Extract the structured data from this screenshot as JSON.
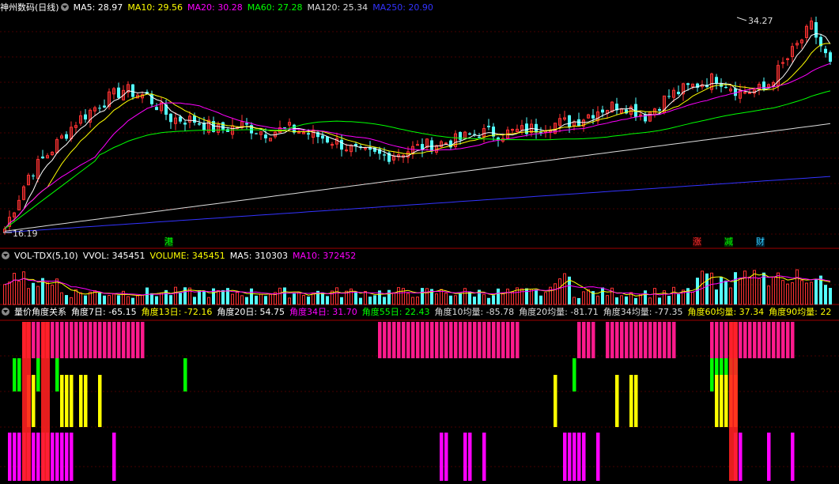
{
  "panels": {
    "price": {
      "title": "神州数码(日线)",
      "ma_items": [
        {
          "label": "MA5: 28.97",
          "color": "#ffffff"
        },
        {
          "label": "MA10: 29.56",
          "color": "#ffff00"
        },
        {
          "label": "MA20: 30.28",
          "color": "#ff00ff"
        },
        {
          "label": "MA60: 27.28",
          "color": "#00ff00"
        },
        {
          "label": "MA120: 25.34",
          "color": "#dddddd"
        },
        {
          "label": "MA250: 20.90",
          "color": "#3333ff"
        }
      ],
      "high_label": "34.27",
      "low_label": "16.19",
      "badges": [
        {
          "text": "港",
          "color": "#00ff00",
          "bg": "#003300"
        },
        {
          "text": "涨",
          "color": "#ff3333",
          "bg": "#330000"
        },
        {
          "text": "减",
          "color": "#00ff00",
          "bg": "#003300"
        },
        {
          "text": "财",
          "color": "#33ccff",
          "bg": "#002233"
        }
      ]
    },
    "volume": {
      "title": "VOL-TDX(5,10)",
      "items": [
        {
          "label": "VVOL: 345451",
          "color": "#ffffff"
        },
        {
          "label": "VOLUME: 345451",
          "color": "#ffff00"
        },
        {
          "label": "MA5: 310303",
          "color": "#ffffff"
        },
        {
          "label": "MA10: 372452",
          "color": "#ff00ff"
        }
      ]
    },
    "angle": {
      "title": "量价角度关系",
      "items": [
        {
          "label": "角度7日: -65.15",
          "color": "#ffffff"
        },
        {
          "label": "角度13日: -72.16",
          "color": "#ffff00"
        },
        {
          "label": "角度20日: 54.75",
          "color": "#ffffff"
        },
        {
          "label": "角度34日: 31.70",
          "color": "#ff00ff"
        },
        {
          "label": "角度55日: 22.43",
          "color": "#00ff00"
        },
        {
          "label": "角度10均量: -85.78",
          "color": "#dddddd"
        },
        {
          "label": "角度20均量: -81.71",
          "color": "#dddddd"
        },
        {
          "label": "角度34均量: -77.35",
          "color": "#dddddd"
        },
        {
          "label": "角度60均量: 37.34",
          "color": "#ffff00"
        },
        {
          "label": "角度90均量: 22",
          "color": "#ffff00"
        }
      ]
    }
  },
  "colors": {
    "up": "#ff3232",
    "down": "#54ffff",
    "grid": "#8b0000",
    "ma5": "#ffffff",
    "ma10": "#ffff00",
    "ma20": "#ff00ff",
    "ma60": "#00ff00",
    "ma120": "#dddddd",
    "ma250": "#3333ff",
    "angle_pink": "#ff1a8c",
    "angle_green": "#00ff00",
    "angle_yellow": "#ffff00",
    "angle_magenta": "#ff00ff",
    "angle_red": "#ff2020"
  },
  "chart_data": {
    "type": "candlestick",
    "count": 175,
    "ylim": [
      16.19,
      34.27
    ],
    "ohlc_anchors": [
      [
        0,
        16.5
      ],
      [
        5,
        21.0
      ],
      [
        10,
        23.2
      ],
      [
        15,
        25.5
      ],
      [
        20,
        27.0
      ],
      [
        25,
        28.2
      ],
      [
        30,
        27.6
      ],
      [
        35,
        25.8
      ],
      [
        40,
        25.6
      ],
      [
        45,
        24.8
      ],
      [
        50,
        25.2
      ],
      [
        55,
        24.6
      ],
      [
        60,
        24.9
      ],
      [
        65,
        24.4
      ],
      [
        70,
        23.8
      ],
      [
        75,
        22.8
      ],
      [
        80,
        22.6
      ],
      [
        85,
        23.1
      ],
      [
        90,
        23.6
      ],
      [
        95,
        23.9
      ],
      [
        100,
        24.6
      ],
      [
        105,
        24.5
      ],
      [
        110,
        24.8
      ],
      [
        115,
        25.3
      ],
      [
        120,
        25.5
      ],
      [
        125,
        26.5
      ],
      [
        130,
        27.0
      ],
      [
        135,
        26.0
      ],
      [
        140,
        27.7
      ],
      [
        145,
        28.5
      ],
      [
        150,
        29.2
      ],
      [
        155,
        28.0
      ],
      [
        160,
        28.2
      ],
      [
        165,
        30.8
      ],
      [
        170,
        33.5
      ],
      [
        174,
        30.2
      ]
    ],
    "ma_end_values": {
      "MA5": 28.97,
      "MA10": 29.56,
      "MA20": 30.28,
      "MA60": 27.28,
      "MA120": 25.34,
      "MA250": 20.9
    },
    "volume_note": "bars per day, MA5 and MA10 lines",
    "angle_rows": [
      "pink",
      "green",
      "yellow",
      "magenta"
    ]
  }
}
